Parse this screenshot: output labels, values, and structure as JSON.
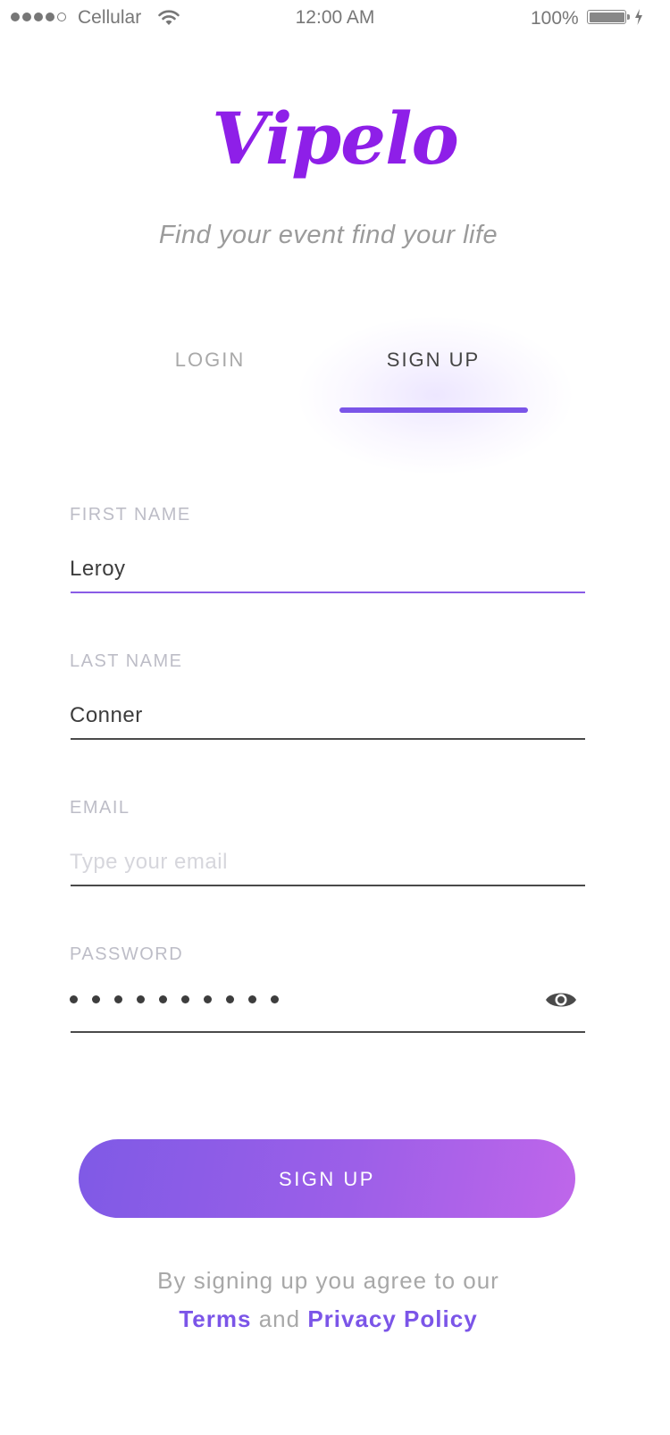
{
  "status_bar": {
    "carrier": "Cellular",
    "time": "12:00 AM",
    "battery_percent": "100%",
    "signal_bars_filled": 4,
    "signal_bars_total": 5
  },
  "header": {
    "logo_text": "Vipelo",
    "tagline": "Find your event find your life"
  },
  "tabs": [
    {
      "label": "LOGIN",
      "active": false
    },
    {
      "label": "SIGN UP",
      "active": true
    }
  ],
  "form": {
    "first_name": {
      "label": "FIRST NAME",
      "value": "Leroy",
      "focused": true
    },
    "last_name": {
      "label": "LAST NAME",
      "value": "Conner"
    },
    "email": {
      "label": "EMAIL",
      "value": "",
      "placeholder": "Type your email"
    },
    "password": {
      "label": "PASSWORD",
      "masked_length": 10,
      "toggle_icon": "eye-icon"
    }
  },
  "submit_button": {
    "label": "SIGN UP"
  },
  "terms": {
    "prefix": "By signing up you agree to our",
    "terms_link": "Terms",
    "conjunction": "and",
    "privacy_link": "Privacy Policy"
  },
  "colors": {
    "brand": "#8e1fe8",
    "accent": "#7b55e8",
    "button_gradient_start": "#7f5ae6",
    "button_gradient_end": "#bf66ea"
  }
}
